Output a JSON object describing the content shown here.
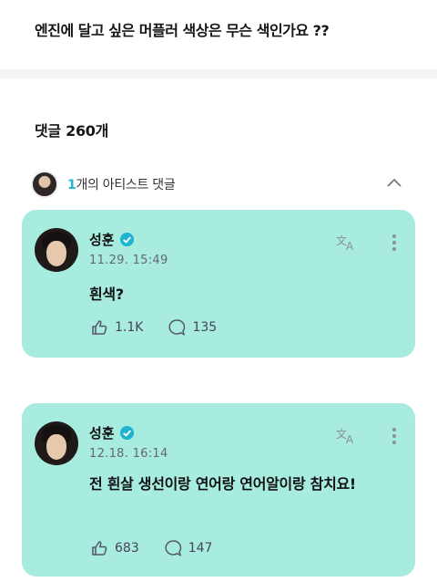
{
  "post": {
    "question": "엔진에 달고 싶은 머플러 색상은 무슨 색인가요 ??"
  },
  "comments_header": {
    "label": "댓글 260개"
  },
  "artist_section": {
    "count": "1",
    "label": "개의 아티스트 댓글"
  },
  "comments": [
    {
      "author": "성훈",
      "date": "11.29. 15:49",
      "text": "흰색?",
      "likes": "1.1K",
      "replies": "135"
    },
    {
      "author": "성훈",
      "date": "12.18. 16:14",
      "text": "전 흰살 생선이랑 연어랑 연어알이랑 참치요!",
      "likes": "683",
      "replies": "147"
    }
  ],
  "colors": {
    "card_background": "#a8ecdf",
    "accent": "#1fb4cf",
    "verified": "#1fb4cf"
  }
}
